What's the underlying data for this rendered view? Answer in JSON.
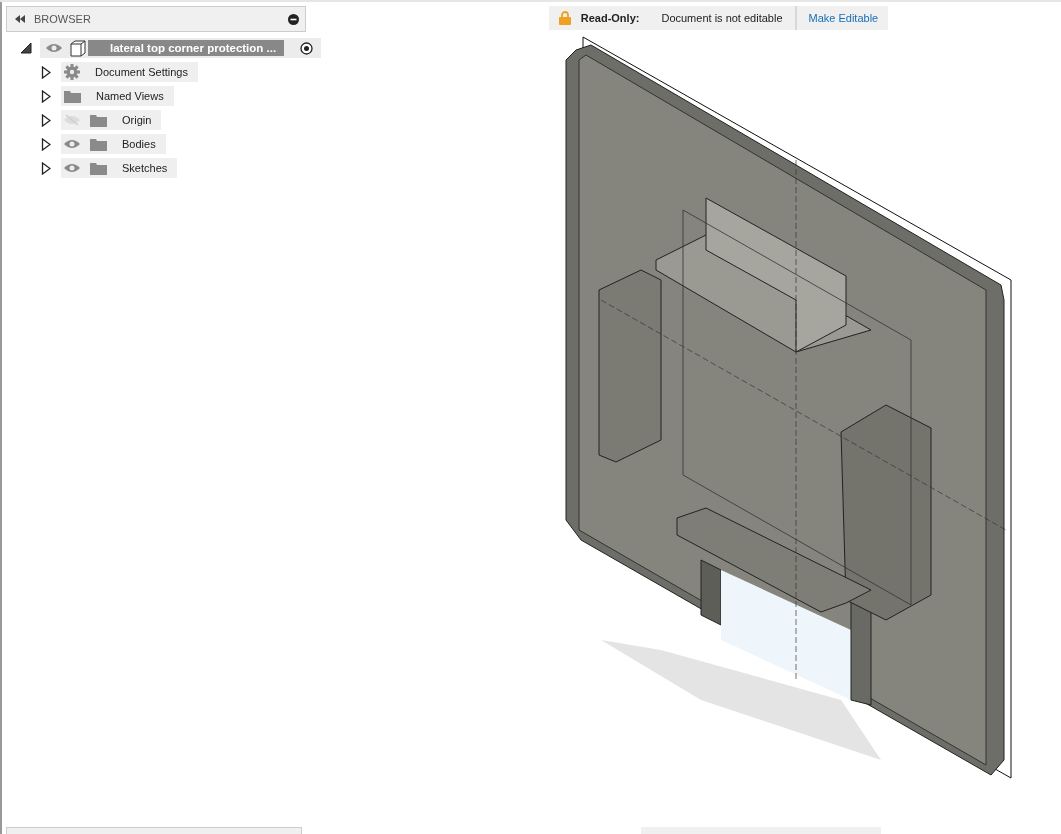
{
  "browser": {
    "title": "BROWSER",
    "root": {
      "label": "lateral top corner protection ...",
      "expanded": true,
      "visible": true,
      "active": true,
      "children": [
        {
          "label": "Document Settings",
          "kind": "settings",
          "expanded": false
        },
        {
          "label": "Named Views",
          "kind": "folder",
          "expanded": false
        },
        {
          "label": "Origin",
          "kind": "folder",
          "visible": false,
          "expanded": false
        },
        {
          "label": "Bodies",
          "kind": "folder",
          "visible": true,
          "expanded": false
        },
        {
          "label": "Sketches",
          "kind": "folder",
          "visible": true,
          "expanded": false
        }
      ]
    }
  },
  "banner": {
    "label": "Read-Only:",
    "message": "Document is not editable",
    "action": "Make Editable"
  }
}
